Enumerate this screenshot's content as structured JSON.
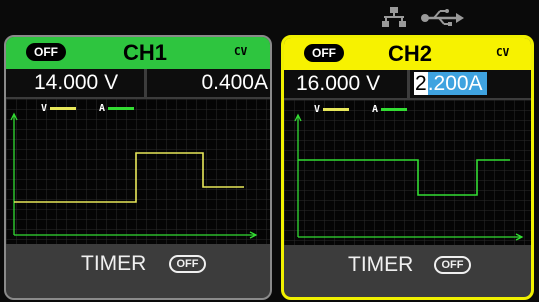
{
  "status": {
    "network_icon": "network-icon",
    "usb_icon": "usb-icon"
  },
  "colors": {
    "ch1_accent": "#2ec53f",
    "ch2_accent": "#f7f200",
    "voltage_trace": "#e8e85a",
    "current_trace": "#33dd33",
    "selection": "#3fa3e0"
  },
  "channels": [
    {
      "output_state": "OFF",
      "name": "CH1",
      "mode": "CV",
      "voltage": "14.000 V",
      "current": "0.400A",
      "legend_v": "V",
      "legend_a": "A",
      "timer_label": "TIMER",
      "timer_state": "OFF"
    },
    {
      "output_state": "OFF",
      "name": "CH2",
      "mode": "CV",
      "voltage": "16.000 V",
      "current_cursor_digit": "2",
      "current_rest": ".200A",
      "legend_v": "V",
      "legend_a": "A",
      "timer_label": "TIMER",
      "timer_state": "OFF"
    }
  ]
}
